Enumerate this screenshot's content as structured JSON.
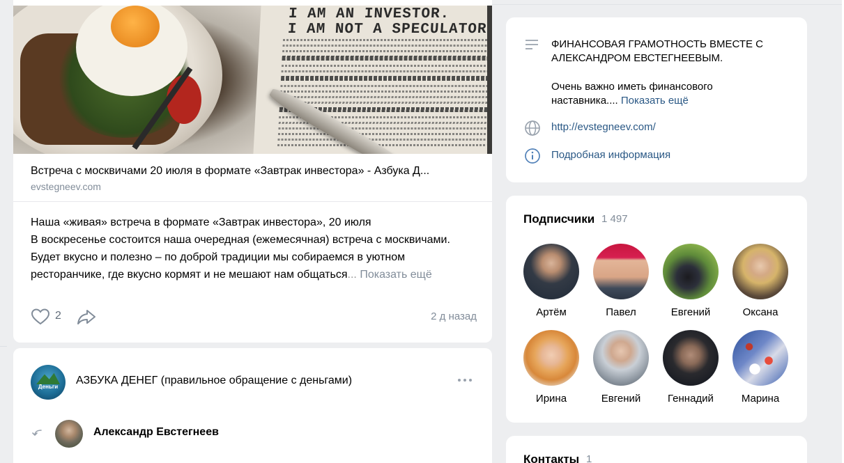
{
  "post": {
    "link_title": "Встреча с москвичами 20 июля в формате «Завтрак инвестора» - Азбука Д...",
    "link_domain": "evstegneev.com",
    "image_text": "I AM AN INVESTOR.\nI AM NOT A SPECULATOR.",
    "text_line1": "Наша «живая» встреча в формате «Завтрак инвестора», 20 июля",
    "text_line2": "В воскресенье состоится наша очередная (ежемесячная) встреча с москвичами.",
    "text_line3": "Будет вкусно и полезно – по доброй традиции мы собираемся в уютном",
    "text_line4": "ресторанчике, где вкусно кормят и не мешают нам общаться",
    "text_line4_fade": "...",
    "show_more": "Показать ещё",
    "likes": "2",
    "time": "2 д назад",
    "like_icon": "heart-icon",
    "share_icon": "share-arrow-icon"
  },
  "repost": {
    "group_name": "АЗБУКА ДЕНЕГ (правильное обращение с деньгами)",
    "group_avatar_label": "Деньги",
    "user_name": "Александр Евстегнеев"
  },
  "info": {
    "title": "ФИНАНСОВАЯ ГРАМОТНОСТЬ ВМЕСТЕ С АЛЕКСАНДРОМ ЕВСТЕГНЕЕВЫМ.",
    "description": "Очень важно иметь финансового наставника....",
    "show_more": "Показать ещё",
    "website": "http://evstegneev.com/",
    "details": "Подробная информация"
  },
  "subscribers": {
    "title": "Подписчики",
    "count": "1 497",
    "items": [
      {
        "name": "Артём"
      },
      {
        "name": "Павел"
      },
      {
        "name": "Евгений"
      },
      {
        "name": "Оксана"
      },
      {
        "name": "Ирина"
      },
      {
        "name": "Евгений"
      },
      {
        "name": "Геннадий"
      },
      {
        "name": "Марина"
      }
    ]
  },
  "contacts": {
    "title": "Контакты",
    "count": "1"
  },
  "colors": {
    "link": "#2a5885",
    "secondary_text": "#818c99",
    "background": "#edeef0"
  }
}
